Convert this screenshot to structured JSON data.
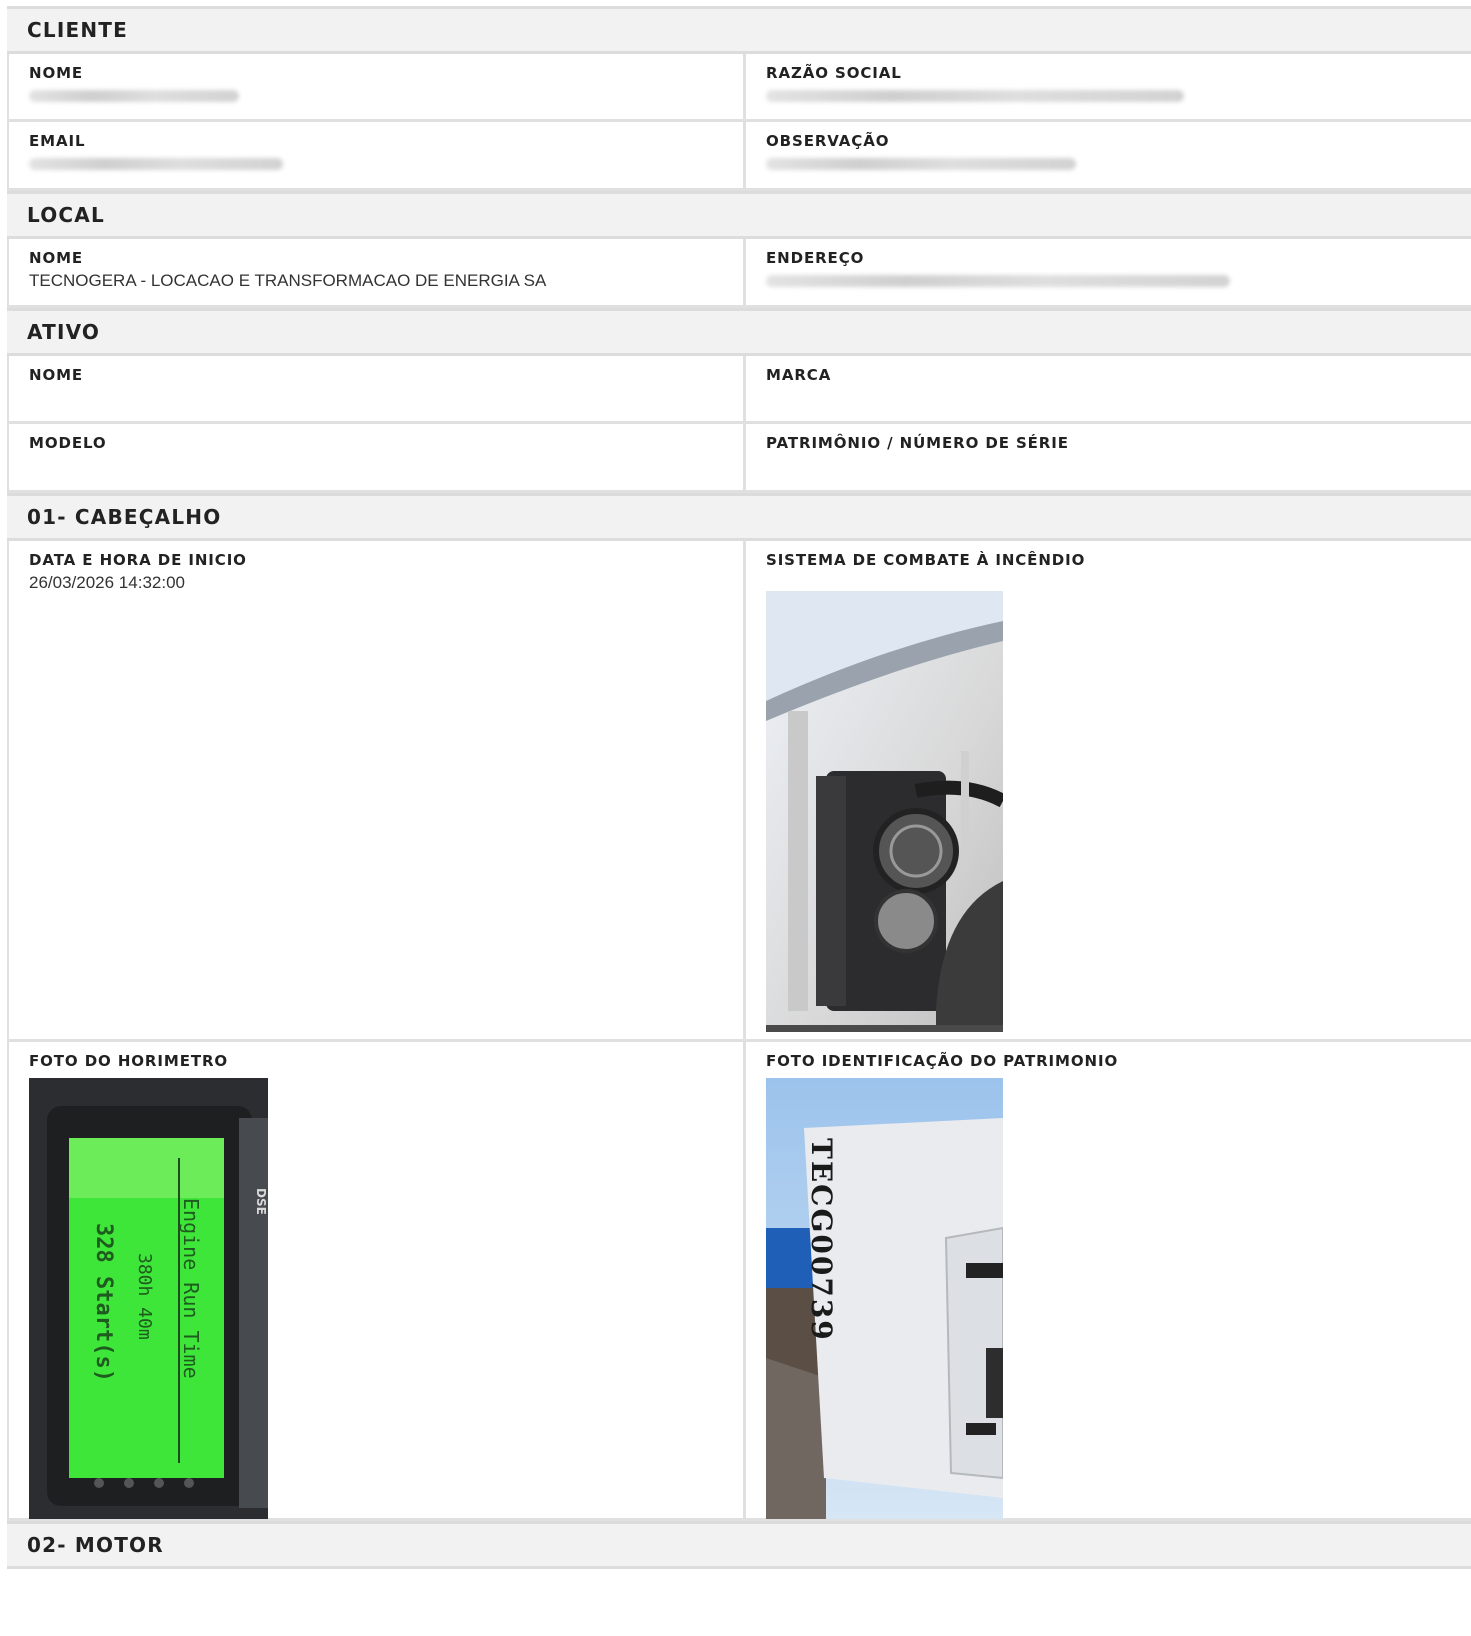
{
  "sections": {
    "cliente": {
      "title": "CLIENTE",
      "nome_label": "NOME",
      "razao_label": "RAZÃO SOCIAL",
      "email_label": "EMAIL",
      "obs_label": "OBSERVAÇÃO"
    },
    "local": {
      "title": "LOCAL",
      "nome_label": "NOME",
      "nome_value": "TECNOGERA - LOCACAO E TRANSFORMACAO DE ENERGIA SA",
      "endereco_label": "ENDEREÇO"
    },
    "ativo": {
      "title": "ATIVO",
      "nome_label": "NOME",
      "marca_label": "MARCA",
      "modelo_label": "MODELO",
      "patrimonio_label": "PATRIMÔNIO / NÚMERO DE SÉRIE"
    },
    "cabecalho": {
      "title": "01- CABEÇALHO",
      "data_label": "DATA E HORA DE INICIO",
      "data_value": "26/03/2026 14:32:00",
      "incendio_label": "SISTEMA DE COMBATE À INCÊNDIO",
      "horimetro_label": "FOTO DO HORIMETRO",
      "patrimonio_foto_label": "FOTO IDENTIFICAÇÃO DO PATRIMONIO"
    },
    "motor": {
      "title": "02- MOTOR"
    }
  },
  "photos": {
    "horimetro_text": {
      "line1": "Engine Run Time",
      "line2": "380h 40m",
      "line3": "328 Start(s)",
      "brand": "DSE"
    },
    "patrimonio_text": "TECG00739"
  },
  "colors": {
    "section_bg": "#f2f2f2",
    "border": "#e0e0e0",
    "lcd_green": "#3fe63a"
  }
}
